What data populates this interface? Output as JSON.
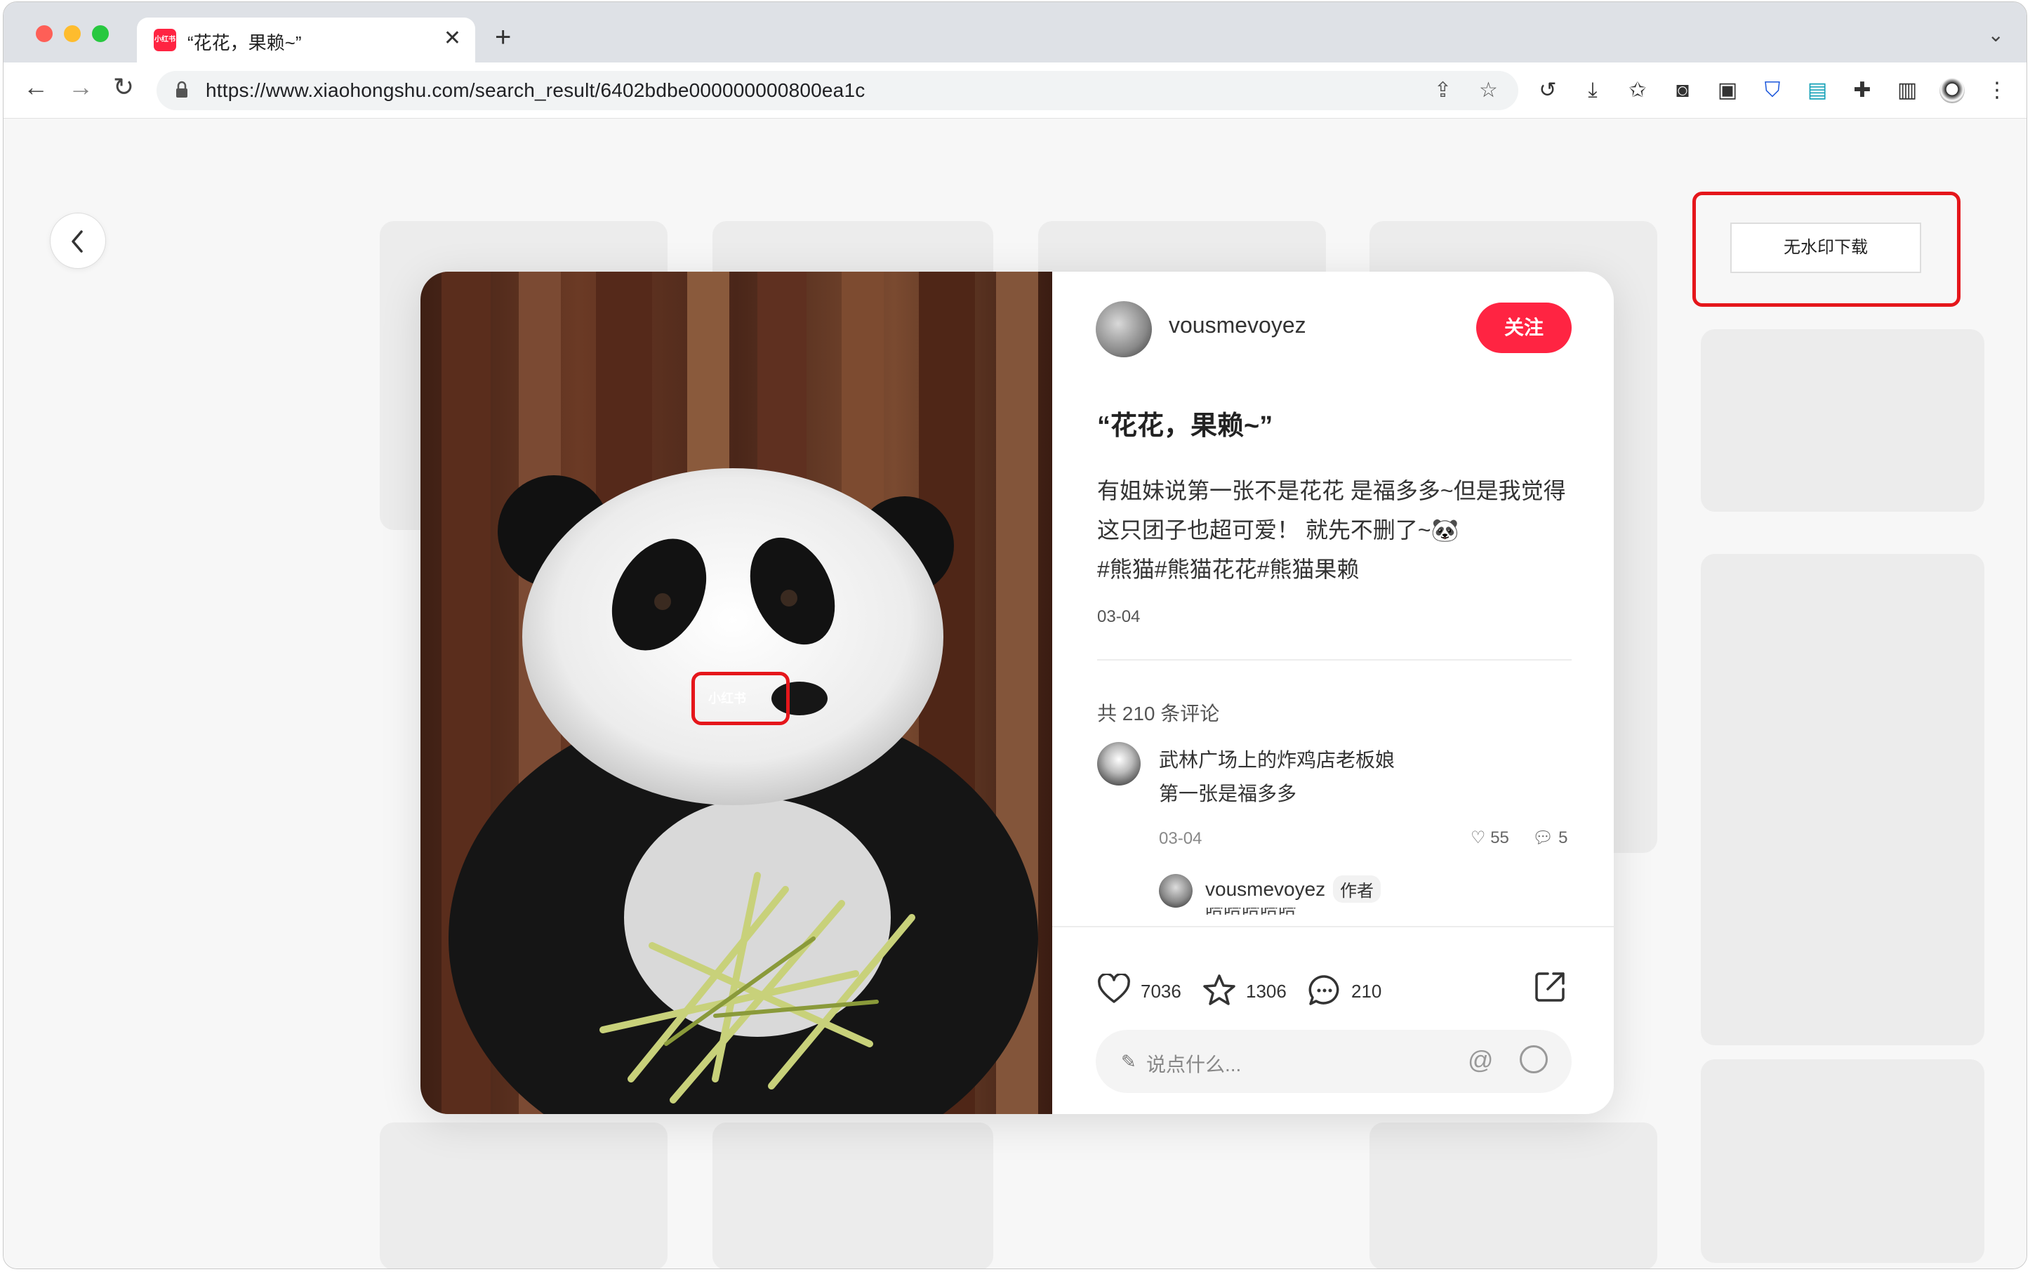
{
  "browser": {
    "tab_title": "“花花，果赖~”",
    "tab_favicon_text": "小红书",
    "url": "https://www.xiaohongshu.com/search_result/6402bdbe000000000800ea1c"
  },
  "toolbar_extra": {
    "download_button": "无水印下载"
  },
  "post": {
    "author": "vousmevoyez",
    "follow_label": "关注",
    "title": "“花花，果赖~”",
    "body_line1": "有姐妹说第一张不是花花 是福多多~但是我觉得",
    "body_line2": "这只团子也超可爱！ 就先不删了~🐼",
    "body_line3": "#熊猫#熊猫花花#熊猫果赖",
    "date": "03-04",
    "image_watermark": "小红书"
  },
  "comments": {
    "count_label": "共 210 条评论",
    "items": [
      {
        "name": "武林广场上的炸鸡店老板娘",
        "text": "第一张是福多多",
        "date": "03-04",
        "likes": "55",
        "replies": "5"
      }
    ],
    "reply": {
      "name": "vousmevoyez",
      "badge": "作者",
      "preview": "哈哈哈哈哈"
    }
  },
  "stats": {
    "likes": "7036",
    "collects": "1306",
    "comments": "210"
  },
  "comment_input": {
    "placeholder": "说点什么..."
  },
  "colors": {
    "brand": "#ff2442",
    "highlight_box": "#e5161b"
  }
}
